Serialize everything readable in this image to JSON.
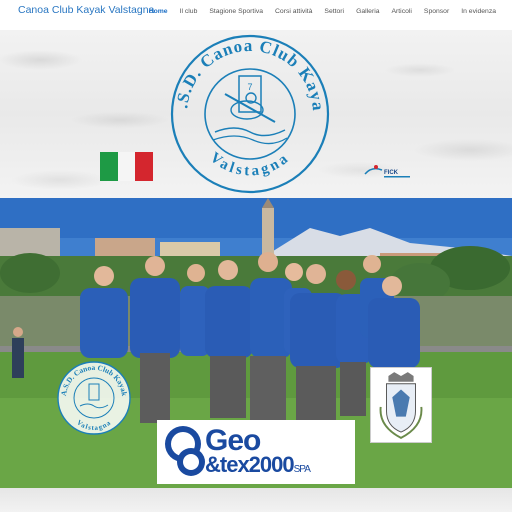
{
  "header": {
    "brand": "Canoa Club Kayak Valstagna",
    "nav": [
      {
        "label": "Home",
        "active": true
      },
      {
        "label": "Il club"
      },
      {
        "label": "Stagione Sportiva"
      },
      {
        "label": "Corsi attività"
      },
      {
        "label": "Settori"
      },
      {
        "label": "Galleria"
      },
      {
        "label": "Articoli"
      },
      {
        "label": "Sponsor"
      },
      {
        "label": "In evidenza"
      }
    ]
  },
  "banner": {
    "logo_text_top": "A.S.D. Canoa Club Kayak",
    "logo_text_bottom": "Valstagna",
    "logo_number": "7",
    "fica_text": "FICK"
  },
  "photo": {
    "small_logo_text_top": "A.S.D. Canoa Club Kayak",
    "small_logo_text_bottom": "Valstagna"
  },
  "sponsor": {
    "line1": "Geo",
    "line2": "&tex2000",
    "line2_suffix": "SPA"
  },
  "colors": {
    "brand": "#2a77c2",
    "active_nav": "#1e70c6",
    "logo_blue": "#1b7fb8",
    "sponsor_blue": "#1a4aa0"
  }
}
